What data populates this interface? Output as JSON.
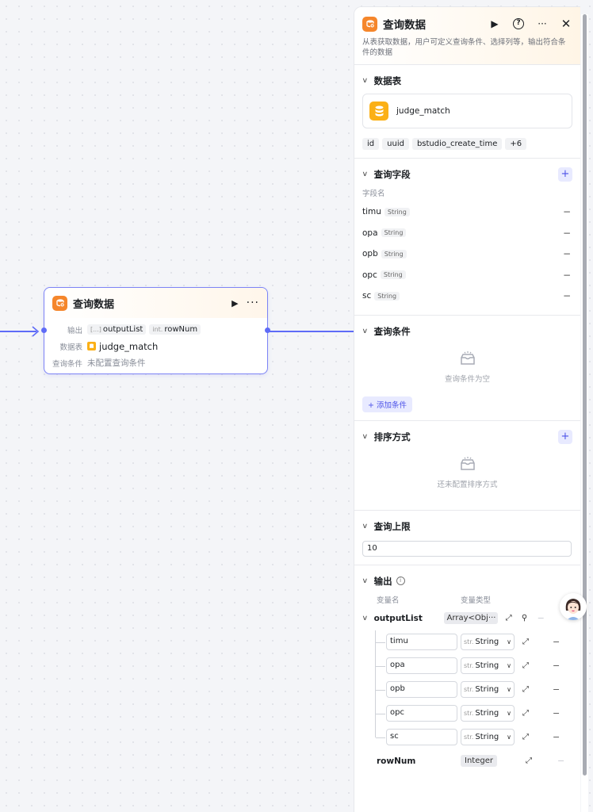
{
  "node": {
    "title": "查询数据",
    "output_label": "输出",
    "output_list_type": "[...]",
    "output_list": "outputList",
    "rownum_type": "int.",
    "rownum": "rowNum",
    "table_label": "数据表",
    "table_value": "judge_match",
    "cond_label": "查询条件",
    "cond_value": "未配置查询条件"
  },
  "panel": {
    "title": "查询数据",
    "description": "从表获取数据，用户可定义查询条件、选择列等，输出符合条件的数据",
    "help_glyph": "?",
    "table_section": {
      "title": "数据表",
      "table_name": "judge_match",
      "columns": [
        "id",
        "uuid",
        "bstudio_create_time",
        "+6"
      ]
    },
    "fields_section": {
      "title": "查询字段",
      "caption": "字段名",
      "fields": [
        {
          "name": "timu",
          "type": "String"
        },
        {
          "name": "opa",
          "type": "String"
        },
        {
          "name": "opb",
          "type": "String"
        },
        {
          "name": "opc",
          "type": "String"
        },
        {
          "name": "sc",
          "type": "String"
        }
      ]
    },
    "conditions_section": {
      "title": "查询条件",
      "empty_text": "查询条件为空",
      "add_label": "+ 添加条件"
    },
    "sort_section": {
      "title": "排序方式",
      "empty_text": "还未配置排序方式"
    },
    "limit_section": {
      "title": "查询上限",
      "value": "10"
    },
    "output_section": {
      "title": "输出",
      "col_name": "变量名",
      "col_type": "变量类型",
      "list_name": "outputList",
      "list_type": "Array<Obj···",
      "children": [
        {
          "name": "timu",
          "type_prefix": "str.",
          "type": "String"
        },
        {
          "name": "opa",
          "type_prefix": "str.",
          "type": "String"
        },
        {
          "name": "opb",
          "type_prefix": "str.",
          "type": "String"
        },
        {
          "name": "opc",
          "type_prefix": "str.",
          "type": "String"
        },
        {
          "name": "sc",
          "type_prefix": "str.",
          "type": "String"
        }
      ],
      "rownum_name": "rowNum",
      "rownum_type": "Integer"
    }
  },
  "colors": {
    "accent": "#4d53e8",
    "node_icon": "#f5862b",
    "db_icon": "#fbb016",
    "edge": "#5e6bf7"
  }
}
